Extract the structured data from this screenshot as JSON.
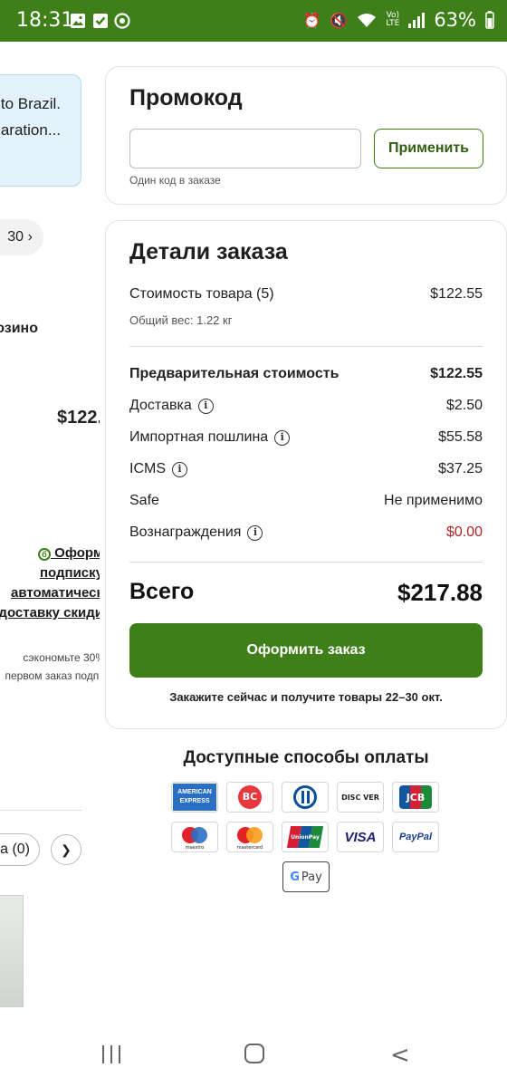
{
  "status_bar": {
    "time": "18:31",
    "battery": "63%"
  },
  "left_panel": {
    "notice_line1": "to Brazil.",
    "notice_line2": "aration...",
    "pill_text": "30",
    "partial_text1": "озино",
    "partial_price": "$122.5",
    "subscribe_link": "Оформ подписку автоматическ доставку скиди",
    "subscribe_note": "сэкономьте 30% первом заказ подпи",
    "cart_pill": "а (0)"
  },
  "promo": {
    "title": "Промокод",
    "input_value": "",
    "apply_label": "Применить",
    "hint": "Один код в заказе"
  },
  "order": {
    "title": "Детали заказа",
    "items_label": "Стоимость товара (5)",
    "items_value": "$122.55",
    "weight": "Общий вес: 1.22 кг",
    "subtotal_label": "Предварительная стоимость",
    "subtotal_value": "$122.55",
    "shipping_label": "Доставка",
    "shipping_value": "$2.50",
    "duty_label": "Импортная пошлина",
    "duty_value": "$55.58",
    "icms_label": "ICMS",
    "icms_value": "$37.25",
    "safe_label": "Safe",
    "safe_value": "Не применимо",
    "rewards_label": "Вознаграждения",
    "rewards_value": "$0.00",
    "total_label": "Всего",
    "total_value": "$217.88",
    "checkout_label": "Оформить заказ",
    "delivery_note": "Закажите сейчас и получите товары 22–30 окт."
  },
  "payment": {
    "title": "Доступные способы оплаты",
    "row1": [
      "american-express",
      "bc-card",
      "diners-club",
      "discover",
      "jcb"
    ],
    "row2": [
      "maestro",
      "mastercard",
      "unionpay",
      "visa",
      "paypal"
    ],
    "row3": [
      "google-pay"
    ],
    "labels": {
      "amex_1": "AMERICAN",
      "amex_2": "EXPRESS",
      "bc": "BC",
      "discover": "DISC VER",
      "jcb": "JCB",
      "maestro": "maestro",
      "mastercard": "mastercard",
      "unionpay": "UnionPay",
      "visa": "VISA",
      "paypal": "PayPal",
      "gpay_g": "G",
      "gpay_pay": "Pay"
    },
    "colors": {
      "brand_green": "#3f7f1a",
      "reward_red": "#b22222"
    }
  }
}
